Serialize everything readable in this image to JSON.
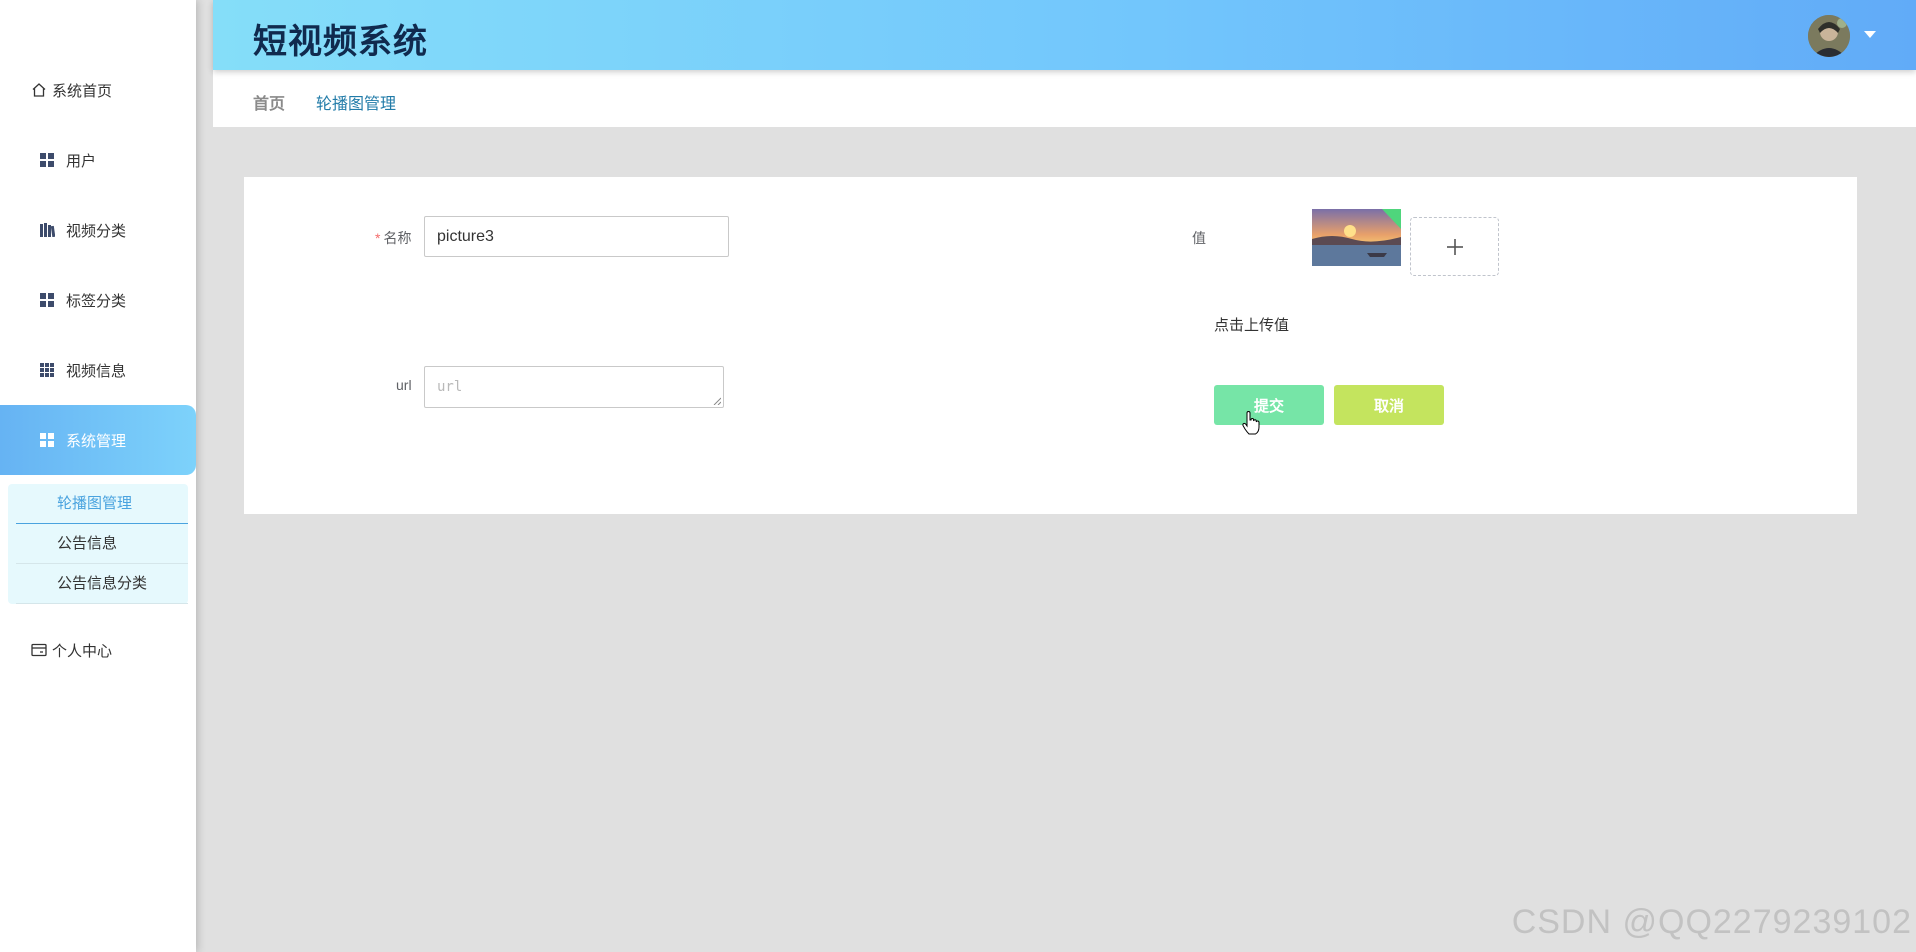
{
  "app": {
    "title": "短视频系统"
  },
  "sidebar": {
    "items": [
      {
        "label": "系统首页",
        "icon": "home-icon"
      },
      {
        "label": "用户",
        "icon": "grid-icon"
      },
      {
        "label": "视频分类",
        "icon": "books-icon"
      },
      {
        "label": "标签分类",
        "icon": "grid-icon"
      },
      {
        "label": "视频信息",
        "icon": "apps-icon"
      },
      {
        "label": "系统管理",
        "icon": "grid-icon",
        "active": true
      },
      {
        "label": "个人中心",
        "icon": "wallet-icon"
      }
    ],
    "submenu": [
      {
        "label": "轮播图管理",
        "selected": true
      },
      {
        "label": "公告信息"
      },
      {
        "label": "公告信息分类"
      }
    ]
  },
  "header": {
    "avatar_icon": "user-avatar",
    "dropdown_icon": "caret-down-icon"
  },
  "breadcrumb": {
    "home": "首页",
    "current": "轮播图管理"
  },
  "form": {
    "name_label": "名称",
    "name_value": "picture3",
    "url_label": "url",
    "url_placeholder": "url",
    "value_label": "值",
    "upload_hint": "点击上传值",
    "upload_icon": "plus-icon",
    "submit_label": "提交",
    "cancel_label": "取消"
  },
  "watermark": "CSDN @QQ2279239102",
  "colors": {
    "active_nav": "#66b3f3",
    "header_gradient_start": "#85def9",
    "header_gradient_end": "#61abf8",
    "submit": "#76e5a7",
    "cancel": "#c4e45e",
    "title": "#102a4e"
  }
}
